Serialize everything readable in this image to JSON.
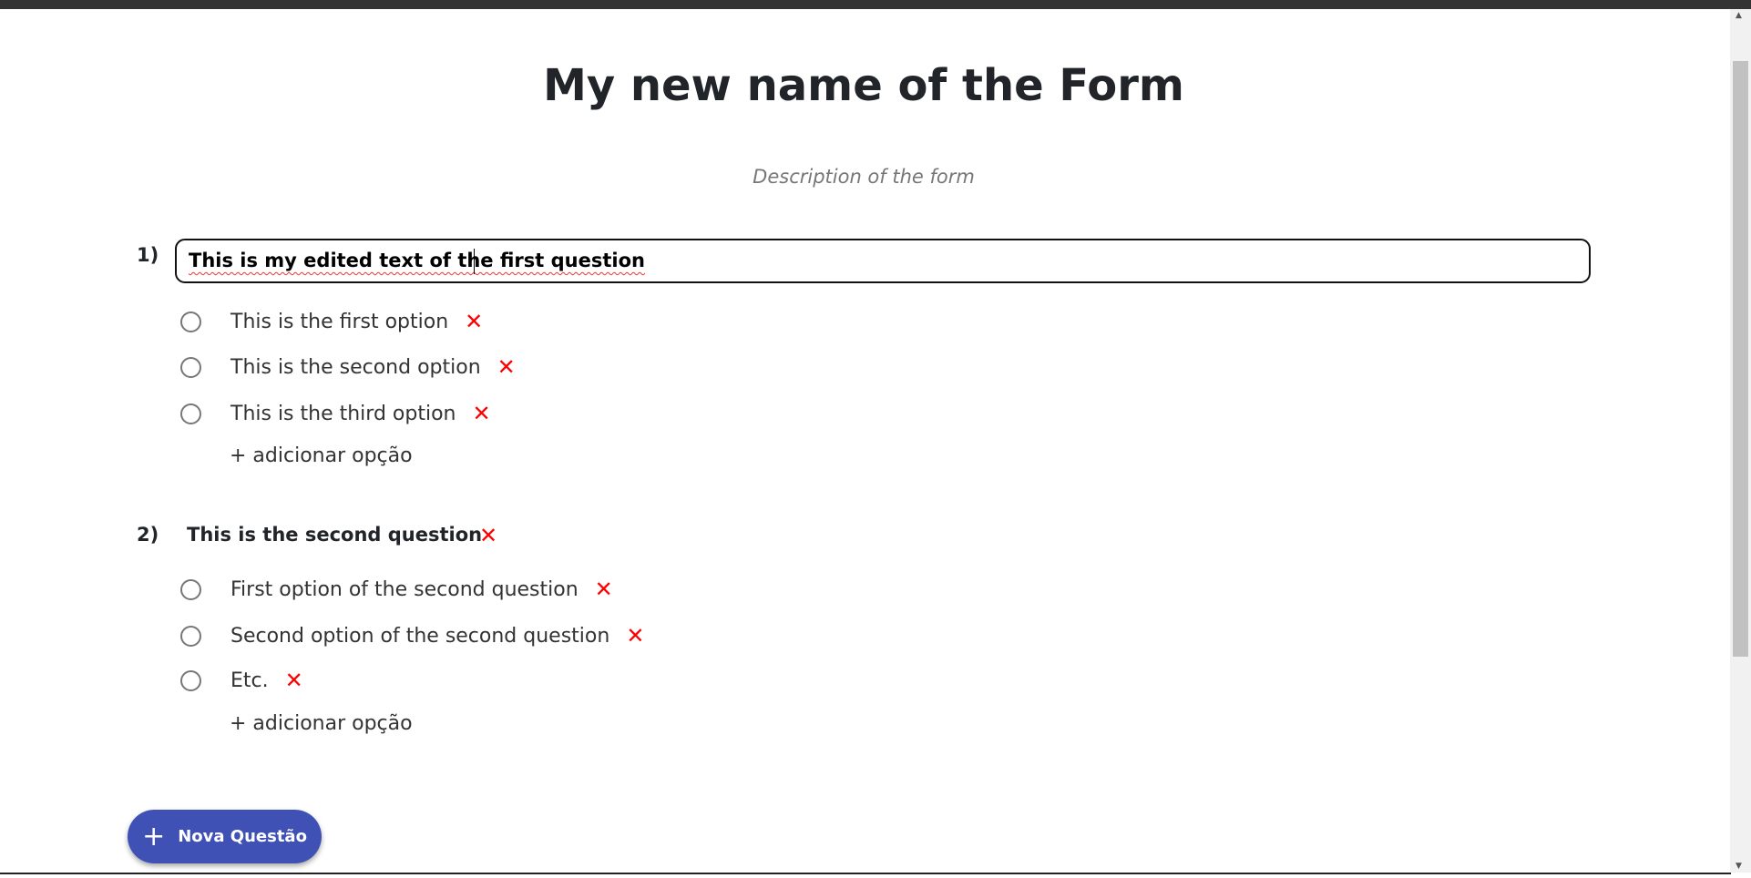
{
  "form": {
    "title": "My new name of the Form",
    "description": "Description of the form"
  },
  "questions": [
    {
      "number": "1)",
      "text": "This is my edited text of the first question",
      "options": [
        "This is the first option",
        "This is the second option",
        "This is the third option"
      ],
      "add_option_label": "+ adicionar opção"
    },
    {
      "number": "2)",
      "text": "This is the second question",
      "options": [
        "First option of the second question",
        "Second option of the second question",
        "Etc."
      ],
      "add_option_label": "+ adicionar opção"
    }
  ],
  "delete_glyph": "✕",
  "new_question_button": {
    "icon": "+",
    "label": "Nova Questão"
  },
  "colors": {
    "accent": "#3f51b5",
    "delete": "#ff0000"
  }
}
